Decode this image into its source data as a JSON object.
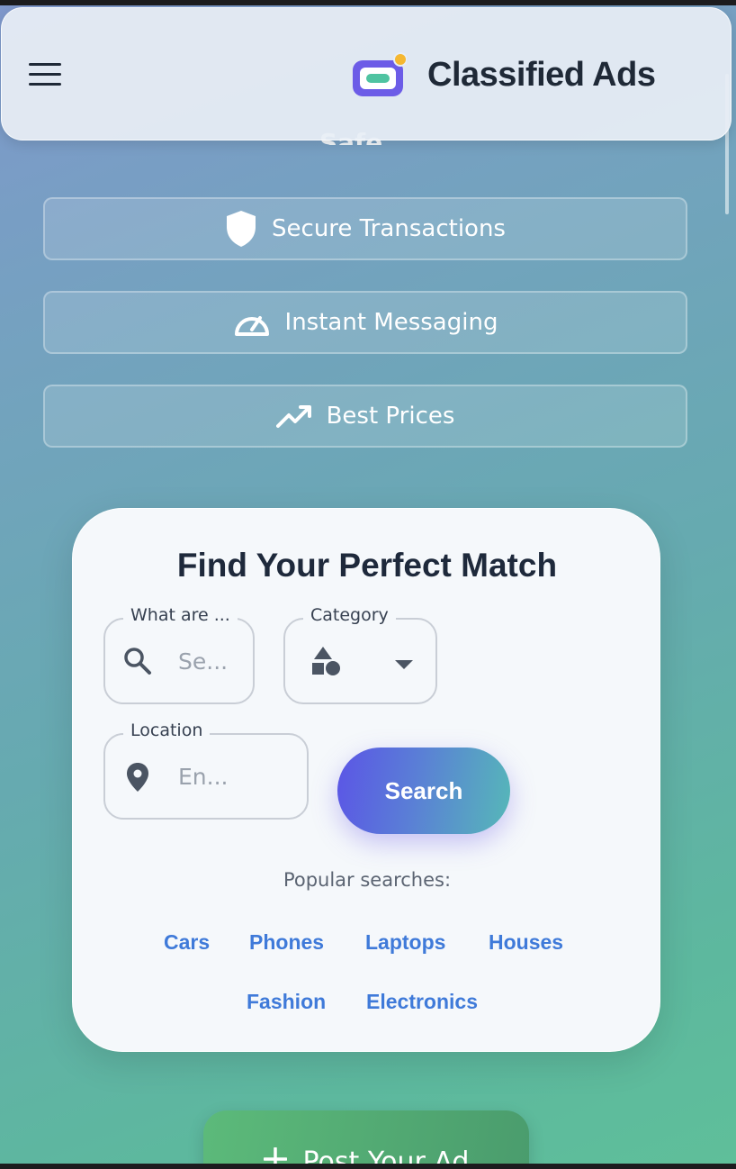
{
  "header": {
    "brand": "Classified Ads",
    "partial_title": "Safe"
  },
  "features": [
    {
      "label": "Secure Transactions",
      "icon": "shield-icon"
    },
    {
      "label": "Instant Messaging",
      "icon": "speedometer-icon"
    },
    {
      "label": "Best Prices",
      "icon": "trending-up-icon"
    }
  ],
  "search_card": {
    "title": "Find Your Perfect Match",
    "what_label": "What are ...",
    "what_placeholder": "Se...",
    "category_label": "Category",
    "location_label": "Location",
    "location_placeholder": "En...",
    "search_button": "Search",
    "popular_label": "Popular searches:",
    "popular_tags": [
      "Cars",
      "Phones",
      "Laptops",
      "Houses",
      "Fashion",
      "Electronics"
    ]
  },
  "post_button": {
    "label": "Post Your Ad"
  },
  "colors": {
    "brand_accent": "#6c5ce7",
    "logo_inner": "#4fc3a1",
    "logo_dot": "#f5b731",
    "tag_link": "#3f7ad9"
  }
}
